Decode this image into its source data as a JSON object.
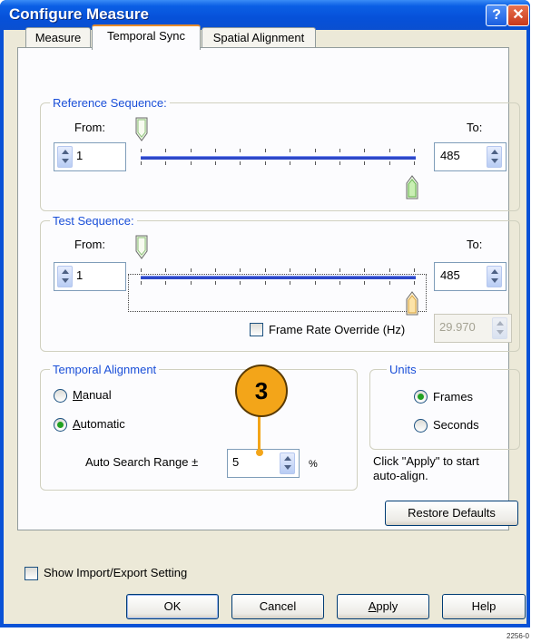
{
  "window": {
    "title": "Configure Measure"
  },
  "tabs": [
    "Measure",
    "Temporal Sync",
    "Spatial Alignment"
  ],
  "reference_sequence": {
    "label": "Reference Sequence:",
    "from_label": "From:",
    "to_label": "To:",
    "from_value": "1",
    "to_value": "485"
  },
  "test_sequence": {
    "label": "Test Sequence:",
    "from_label": "From:",
    "to_label": "To:",
    "from_value": "1",
    "to_value": "485"
  },
  "frame_rate": {
    "label": "Frame Rate Override (Hz)",
    "value": "29.970",
    "checked": false
  },
  "temporal_alignment": {
    "label": "Temporal Alignment",
    "manual": "Manual",
    "automatic": "Automatic",
    "selected": "Automatic",
    "auto_search_label": "Auto Search Range ±",
    "auto_search_value": "5",
    "unit": "%"
  },
  "units": {
    "label": "Units",
    "frames": "Frames",
    "seconds": "Seconds",
    "selected": "Frames"
  },
  "hint": {
    "line1": "Click \"Apply\" to start",
    "line2": "auto-align."
  },
  "restore_defaults": "Restore Defaults",
  "show_import_export": {
    "label": "Show Import/Export Setting",
    "checked": false
  },
  "buttons": {
    "ok": "OK",
    "cancel": "Cancel",
    "apply": "Apply",
    "help": "Help"
  },
  "callout": "3",
  "figure_id": "2256-0",
  "colors": {
    "title_bar": "#0651d9",
    "callout": "#f3a519",
    "group_label": "#1a4fd8"
  }
}
